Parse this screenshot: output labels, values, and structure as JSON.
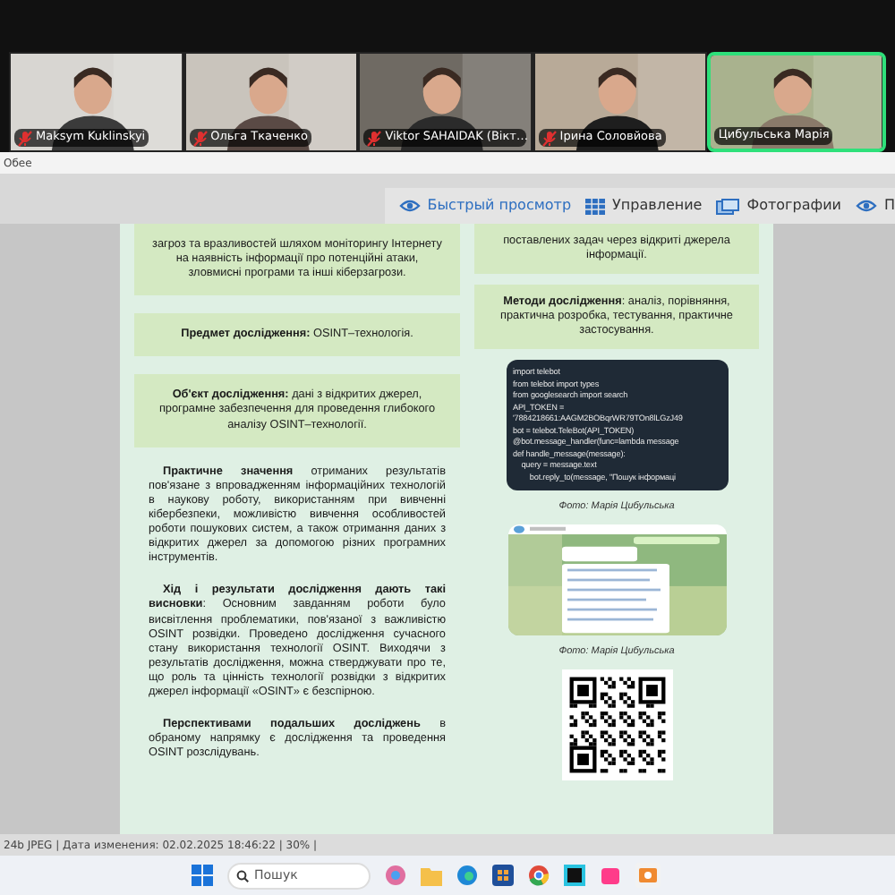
{
  "participants": [
    {
      "name": "Maksym Kuklinskyi",
      "muted": true,
      "speaking": false
    },
    {
      "name": "Ольга Ткаченко",
      "muted": true,
      "speaking": false
    },
    {
      "name": "Viktor SAHAIDAK (Вікт…",
      "muted": true,
      "speaking": false
    },
    {
      "name": "Ірина Соловйова",
      "muted": true,
      "speaking": false
    },
    {
      "name": "Цибульська Марія",
      "muted": false,
      "speaking": true
    }
  ],
  "title_strip": {
    "text": "Обее"
  },
  "toolbar": [
    {
      "label": "Быстрый просмотр",
      "selected": true,
      "kind": "eye"
    },
    {
      "label": "Управление",
      "selected": false,
      "kind": "grid"
    },
    {
      "label": "Фотографии",
      "selected": false,
      "kind": "photos"
    },
    {
      "label": "П",
      "selected": false,
      "kind": "eye"
    }
  ],
  "document": {
    "left": [
      {
        "kind": "card",
        "text": "загроз та вразливостей шляхом моніторингу Інтернету на наявність інформації про потенційні атаки, зловмисні програми та інші кіберзагрози."
      },
      {
        "kind": "card",
        "text": "**Предмет дослідження:** OSINT–технологія."
      },
      {
        "kind": "card",
        "text": "**Об'єкт дослідження:** дані з відкритих джерел, програмне забезпечення для проведення глибокого аналізу OSINT–технології."
      },
      {
        "kind": "paragraph",
        "text": "**Практичне значення** отриманих результатів пов'язане з впровадженням інформаційних технологій в наукову роботу, використанням при вивченні кібербезпеки, можливістю вивчення особливостей роботи пошукових систем, а також отримання даних з відкритих джерел за допомогою різних програмних інструментів."
      },
      {
        "kind": "paragraph",
        "text": "**Хід і результати дослідження дають такі висновки**: Основним завданням роботи було висвітлення проблематики, пов'язаної з важливістю OSINT розвідки. Проведено дослідження сучасного стану використання технології OSINT. Виходячи з результатів дослідження, можна стверджувати про те, що роль та цінність технології розвідки з відкритих джерел інформації «OSINT» є безспірною."
      },
      {
        "kind": "paragraph",
        "text": "**Перспективами подальших досліджень** в обраному напрямку є дослідження та проведення OSINT розслідувань."
      }
    ],
    "right": [
      {
        "kind": "card",
        "text": "поставлених задач через відкриті джерела інформації."
      },
      {
        "kind": "card",
        "text": "**Методи дослідження**:  аналіз, порівняння, практична розробка, тестування, практичне застосування."
      },
      {
        "kind": "code",
        "lines": [
          "import telebot",
          "from telebot import types",
          "from googlesearch import search",
          "API_TOKEN =",
          "'7884218661:AAGM2BOBqrWR79TOn8lLGzJ49",
          "bot = telebot.TeleBot(API_TOKEN)",
          "@bot.message_handler(func=lambda message",
          "def handle_message(message):",
          "    query = message.text",
          "        bot.reply_to(message, \"Пошук інформаці"
        ]
      },
      {
        "kind": "caption",
        "text": "Фото: Марія Цибульська"
      },
      {
        "kind": "picture"
      },
      {
        "kind": "caption",
        "text": "Фото: Марія Цибульська"
      },
      {
        "kind": "qr"
      }
    ]
  },
  "status_bar": {
    "text": "24b JPEG | Дата изменения: 02.02.2025 18:46:22 | 30% |"
  },
  "taskbar": {
    "search": {
      "placeholder": "Пошук"
    }
  }
}
